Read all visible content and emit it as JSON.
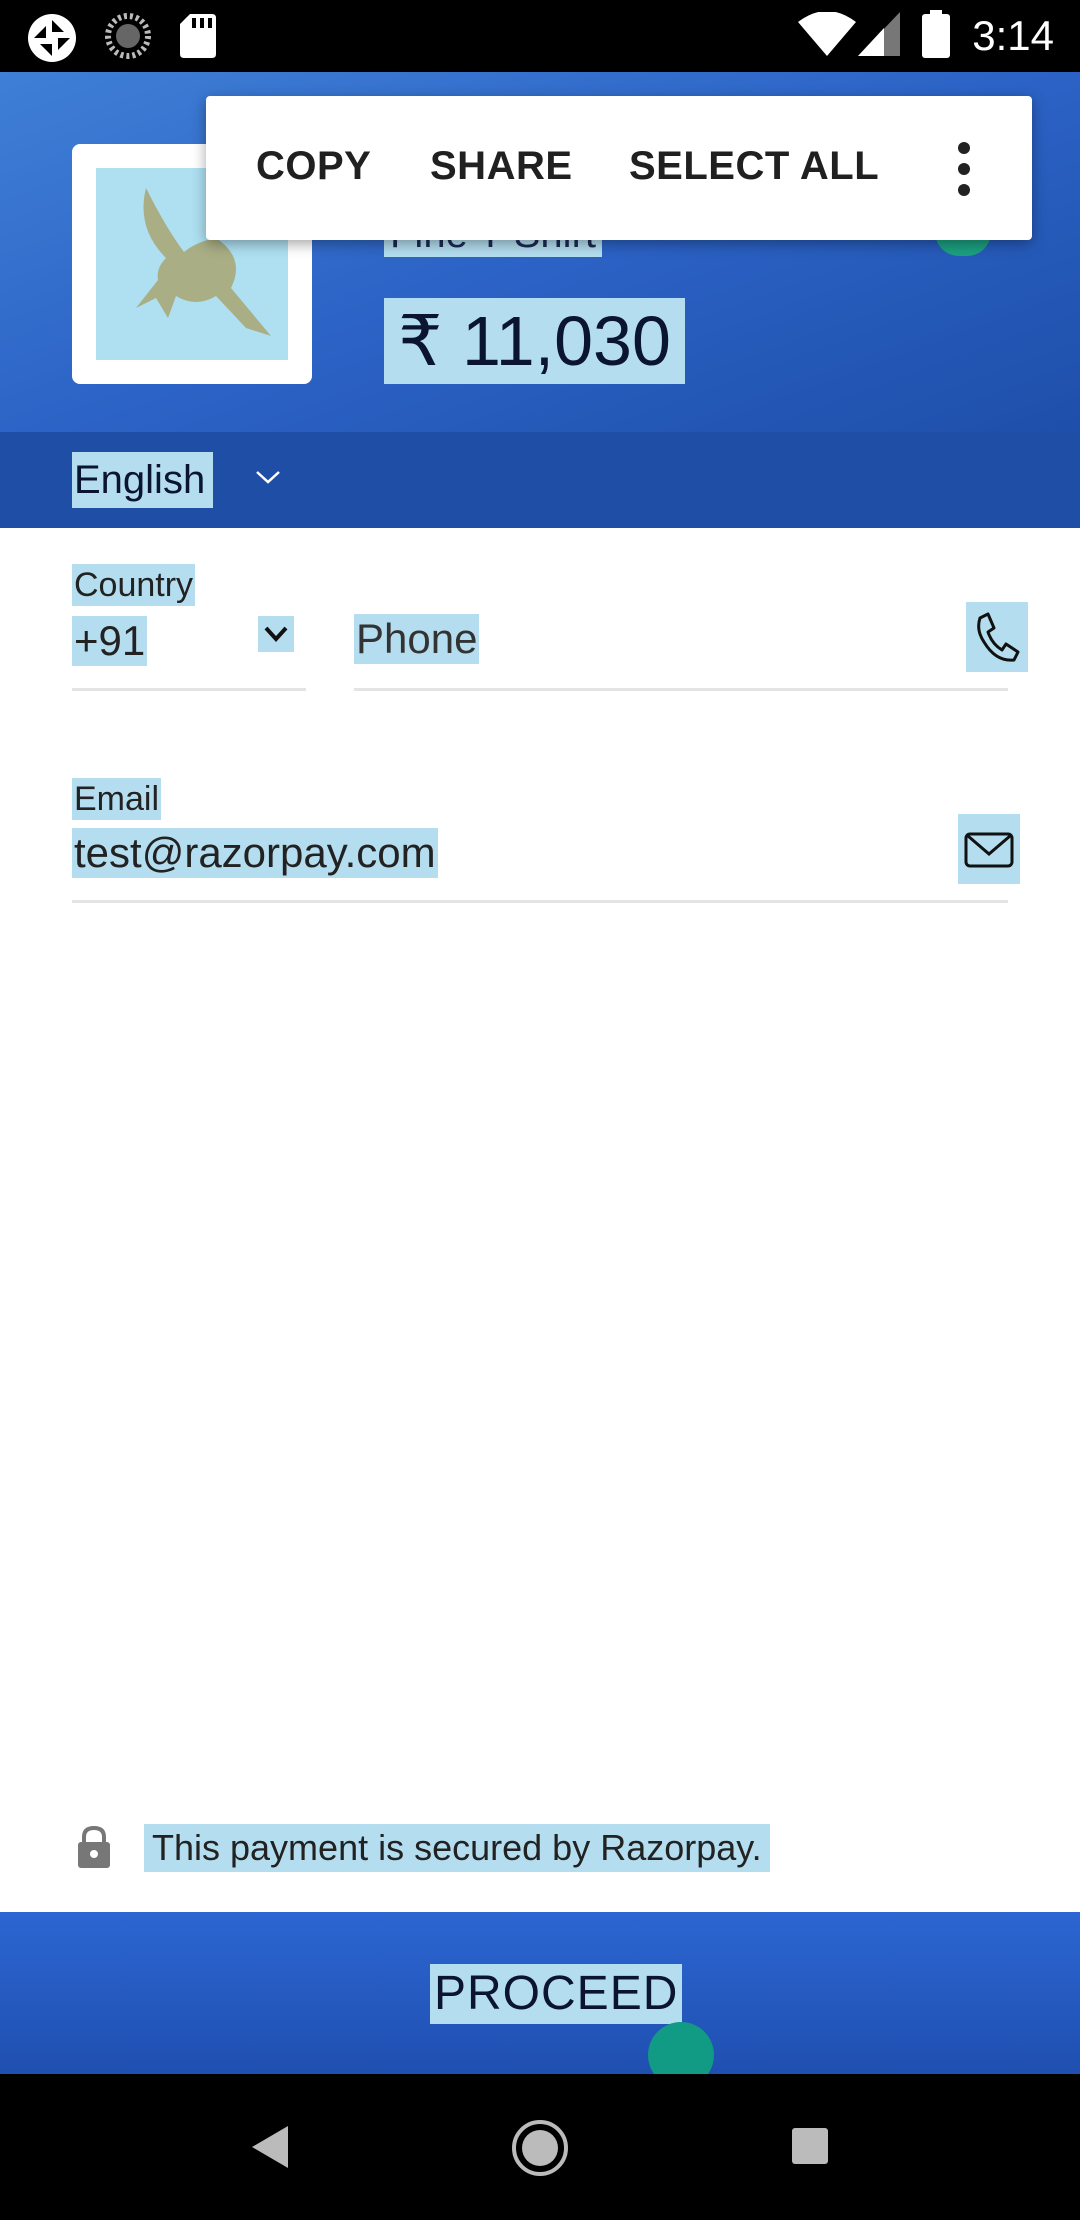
{
  "status_bar": {
    "time": "3:14",
    "icons": [
      "camera-shutter-icon",
      "circle-loader-icon",
      "sd-card-icon",
      "wifi-icon",
      "cell-signal-icon",
      "battery-icon"
    ]
  },
  "header": {
    "product_name": "Fine T-Shirt",
    "price": "₹ 11,030",
    "colors": {
      "gradient_start": "#3f7fd6",
      "gradient_end": "#1e4faa",
      "selection": "#b4def0"
    }
  },
  "context_menu": {
    "copy": "COPY",
    "share": "SHARE",
    "select_all": "SELECT ALL"
  },
  "language": {
    "selected": "English"
  },
  "form": {
    "country_label": "Country",
    "country_code": "+91",
    "phone_placeholder": "Phone",
    "email_label": "Email",
    "email_value": "test@razorpay.com"
  },
  "footer": {
    "secure_text": "This payment is secured by Razorpay.",
    "proceed_label": "PROCEED"
  }
}
